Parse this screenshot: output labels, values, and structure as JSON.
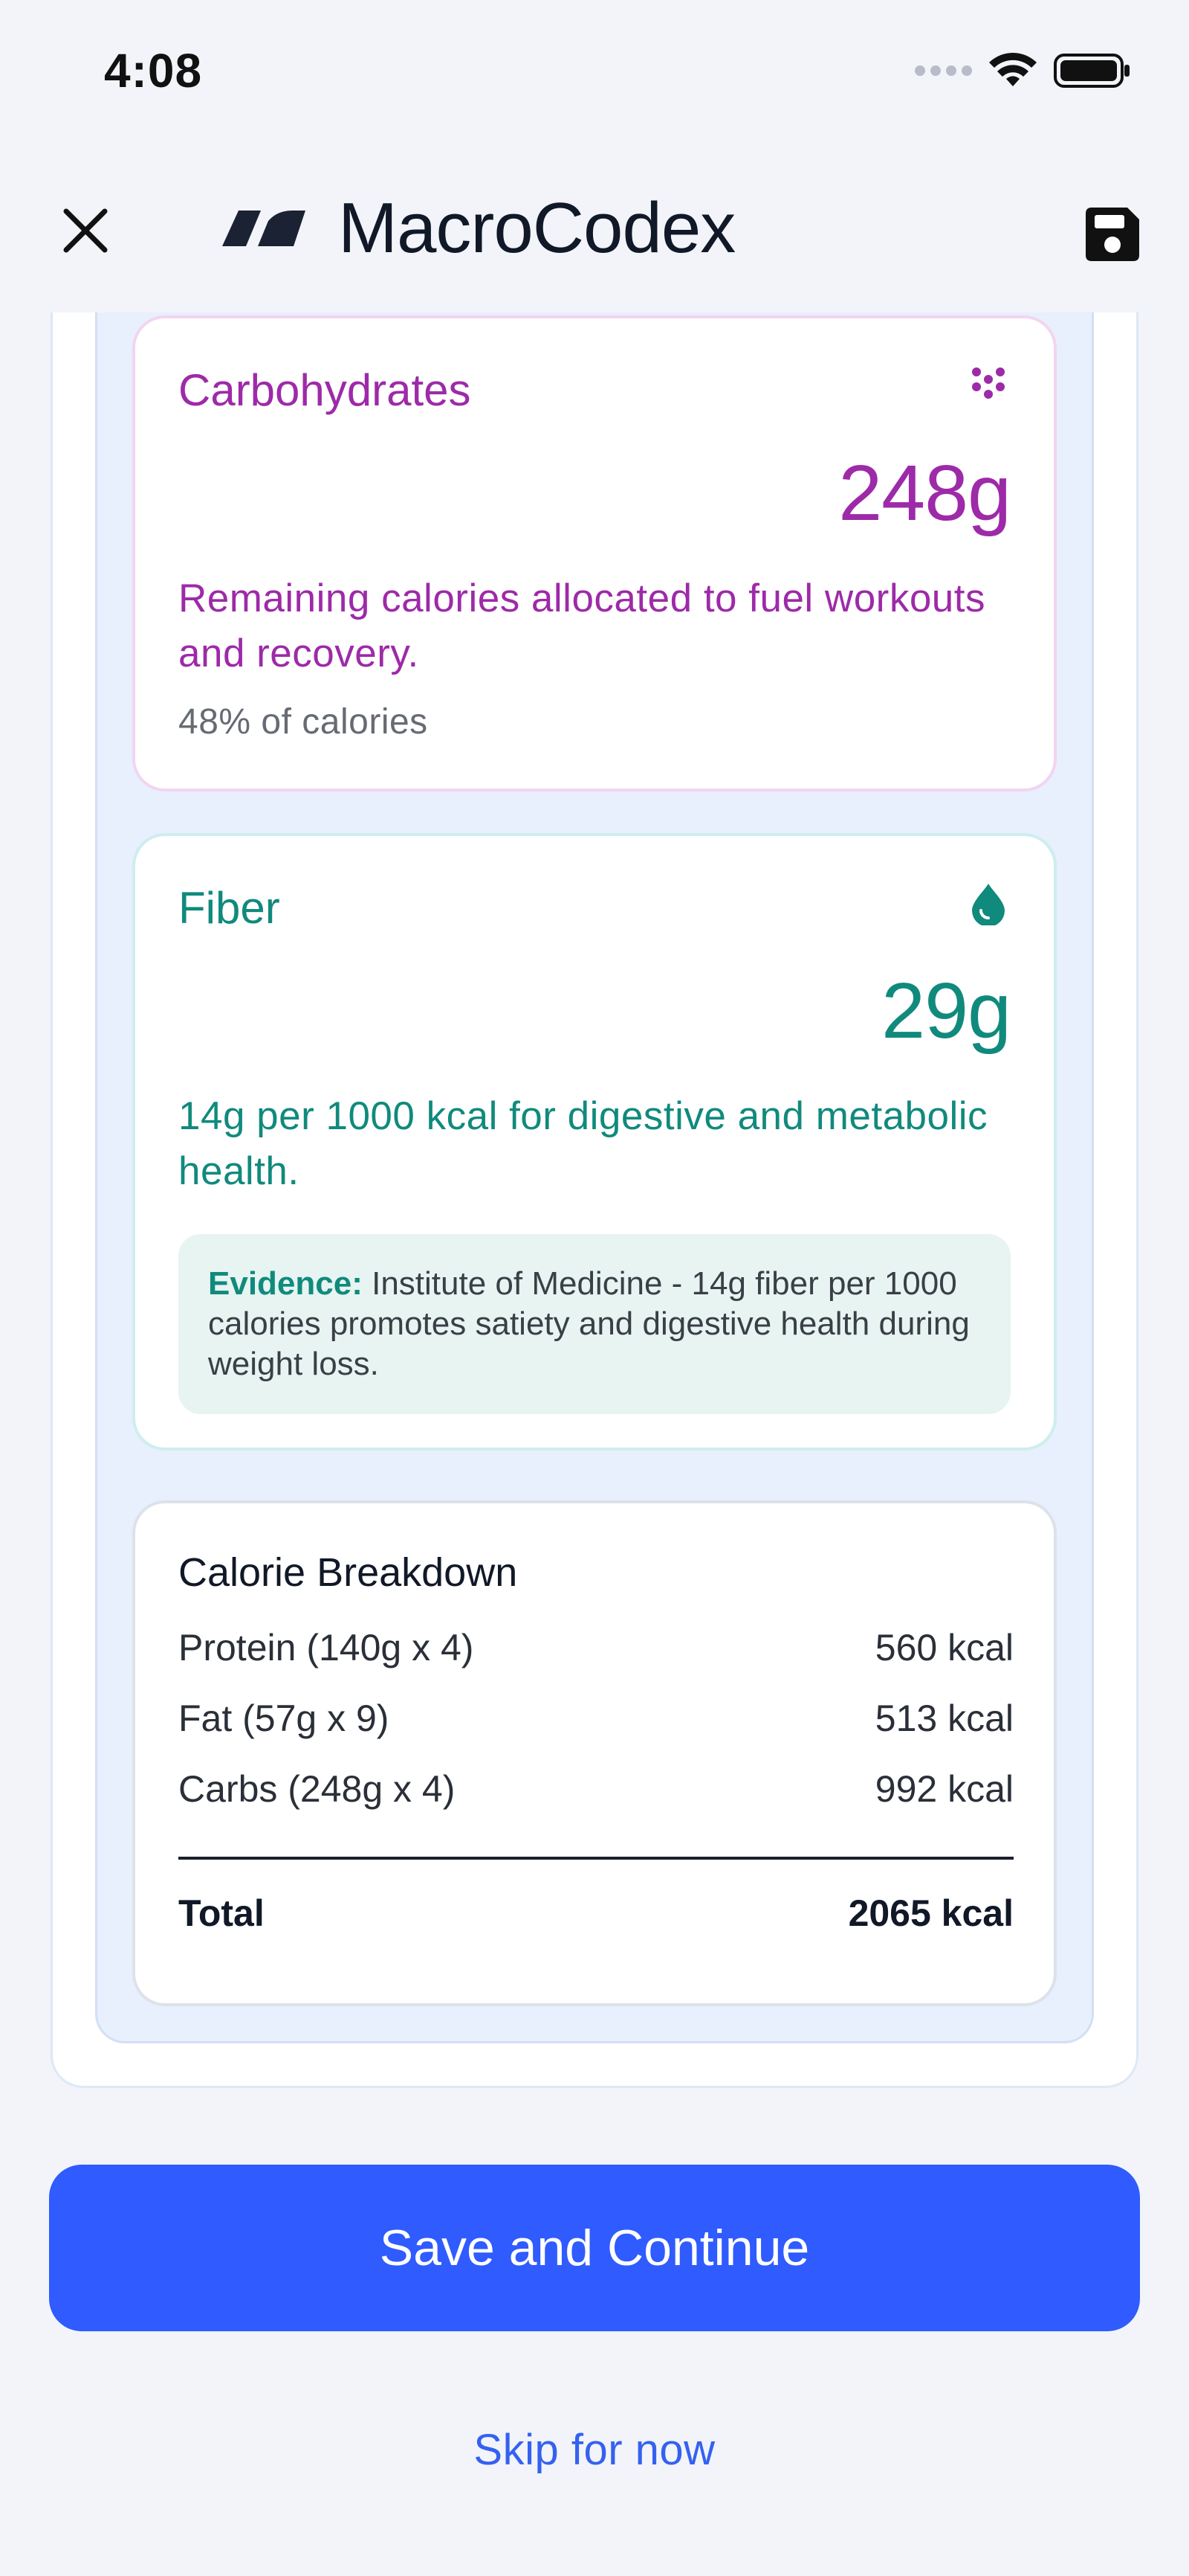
{
  "status_bar": {
    "time": "4:08"
  },
  "header": {
    "app_title": "MacroCodex"
  },
  "carbohydrates": {
    "label": "Carbohydrates",
    "value": "248g",
    "description": "Remaining calories allocated to fuel workouts and recovery.",
    "percent_text": "48% of calories",
    "color": "#9d2aa8",
    "icon": "dots-grid-icon"
  },
  "fiber": {
    "label": "Fiber",
    "value": "29g",
    "description": "14g per 1000 kcal for digestive and metabolic health.",
    "evidence_label": "Evidence:",
    "evidence_text": "Institute of Medicine - 14g fiber per 1000 calories promotes satiety and digestive health during weight loss.",
    "color": "#108a7d",
    "icon": "droplet-icon"
  },
  "breakdown": {
    "title": "Calorie Breakdown",
    "rows": [
      {
        "label": "Protein (140g x 4)",
        "value": "560 kcal"
      },
      {
        "label": "Fat (57g x 9)",
        "value": "513 kcal"
      },
      {
        "label": "Carbs (248g x 4)",
        "value": "992 kcal"
      }
    ],
    "total_label": "Total",
    "total_value": "2065 kcal"
  },
  "actions": {
    "primary_label": "Save and Continue",
    "skip_label": "Skip for now",
    "primary_color": "#2f5bff"
  }
}
